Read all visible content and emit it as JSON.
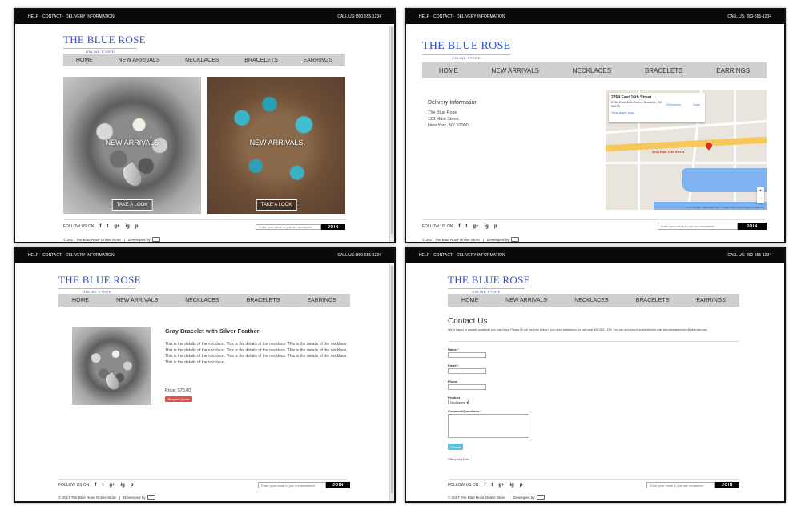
{
  "topbar": {
    "links": [
      "HELP",
      "CONTACT",
      "DELIVERY INFORMATION"
    ],
    "separator": "·",
    "phone": "CALL US: 800-555-1234"
  },
  "logo": {
    "name": "THE BLUE ROSE",
    "tagline": "ONLINE STORE"
  },
  "nav": [
    "HOME",
    "NEW ARRIVALS",
    "NECKLACES",
    "BRACELETS",
    "EARRINGS"
  ],
  "home": {
    "promos": [
      {
        "overlay": "NEW ARRIVALS",
        "button": "TAKE A LOOK"
      },
      {
        "overlay": "NEW ARRIVALS",
        "button": "TAKE A LOOK"
      }
    ]
  },
  "delivery": {
    "heading": "Delivery Information",
    "address_lines": [
      "The Blue Rose",
      "123 Main Street",
      "New York, NY 10000"
    ],
    "map": {
      "card_title": "2764 East 16th Street",
      "card_address": "2764 East 16th Street, Brooklyn, NY 11235",
      "directions": "Directions",
      "save": "Save",
      "larger_map": "View larger map",
      "pin_label": "2764 East 16th Street",
      "attribution": "©2017 Google · Map data ©2017 Google  Terms of Use  Report a map error"
    }
  },
  "product": {
    "title": "Gray Bracelet with Silver Feather",
    "description": "This is the details of the necklace. This is the details of the necklace. This is the details of the necklace. This is the details of the necklace. This is the details of the necklace. This is the details of the necklace. This is the details of the necklace. This is the details of the necklace. This is the details of the necklace. This is the details of the necklace.",
    "price": "Price: $75.00",
    "quote_button": "Request Quote"
  },
  "contact": {
    "heading": "Contact Us",
    "intro": "We're happy to answer questions you may have. Please fill out the form below if you need assistance, or call us at 800-555-1234. You can also reach us via direct e-mail at customerservice@bluerose.com",
    "fields": {
      "name": "Name",
      "email": "Email",
      "phone": "Phone",
      "product": "Product",
      "product_value": "Necklaces",
      "comment": "Comment/Questions"
    },
    "required_mark": "*",
    "submit": "Submit",
    "required_note": "* Required Field"
  },
  "footer": {
    "follow": "FOLLOW US ON",
    "social_icons": [
      "f",
      "t",
      "g+",
      "ig",
      "p"
    ],
    "newsletter_placeholder": "Enter your email to join our newsletter",
    "join": "JOIN",
    "copyright": "© 2017 The Blue Rose Online Store",
    "developed": "Developed by"
  },
  "colors": {
    "brand_blue": "#2d4fd0",
    "nav_gray": "#cfcfcf",
    "quote_red": "#d9534f",
    "submit_blue": "#5bc0de"
  }
}
